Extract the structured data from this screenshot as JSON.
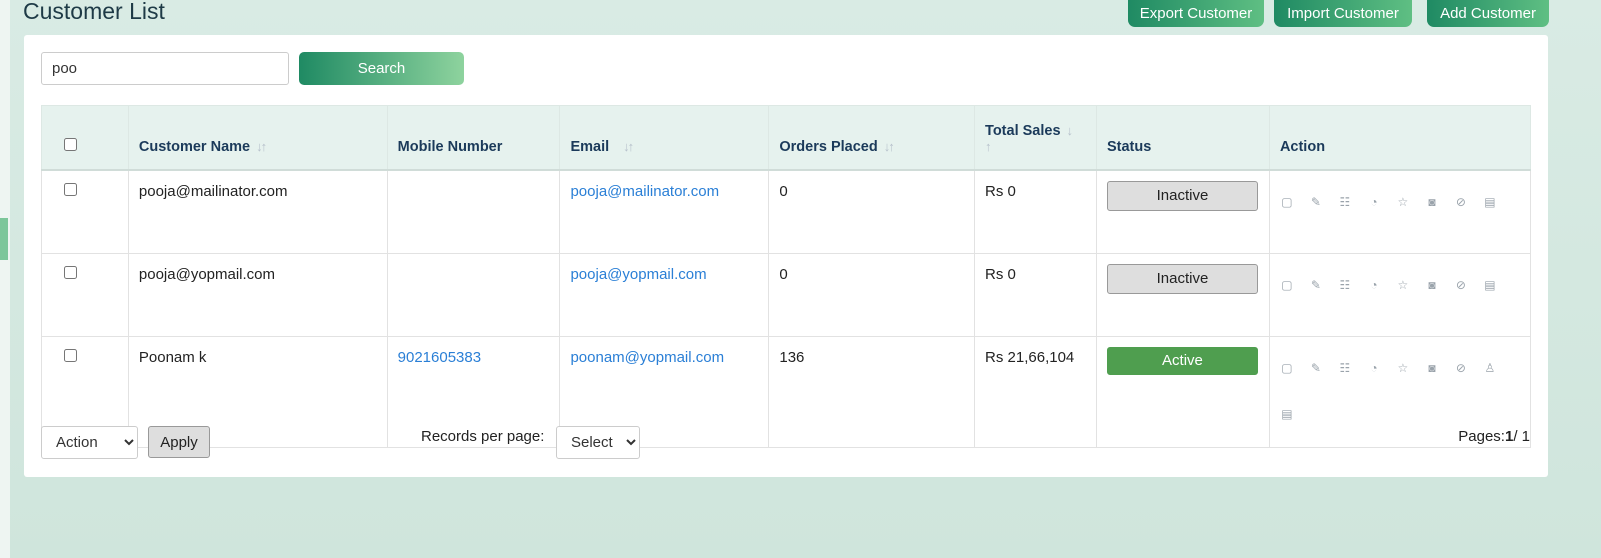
{
  "header": {
    "title": "Customer List",
    "export_label": "Export Customer",
    "import_label": "Import Customer",
    "add_label": "Add Customer"
  },
  "search": {
    "value": "poo",
    "button_label": "Search"
  },
  "table": {
    "columns": {
      "customer_name": "Customer Name",
      "mobile": "Mobile Number",
      "email": "Email",
      "orders": "Orders Placed",
      "total_sales": "Total Sales",
      "status": "Status",
      "action": "Action"
    },
    "rows": [
      {
        "name": "pooja@mailinator.com",
        "mobile": "",
        "email": "pooja@mailinator.com",
        "orders": "0",
        "sales": "Rs 0",
        "status": "Inactive"
      },
      {
        "name": "pooja@yopmail.com",
        "mobile": "",
        "email": "pooja@yopmail.com",
        "orders": "0",
        "sales": "Rs 0",
        "status": "Inactive"
      },
      {
        "name": "Poonam k",
        "mobile": "9021605383",
        "email": "poonam@yopmail.com",
        "orders": "136",
        "sales": "Rs 21,66,104",
        "status": "Active"
      }
    ]
  },
  "footer": {
    "bulk_action": "Action",
    "apply_label": "Apply",
    "records_label": "Records per page:",
    "records_select": "Select",
    "pages_label": "Pages:",
    "pages_current": "1",
    "pages_total": "/ 1"
  },
  "colors": {
    "accent": "#1f8a63",
    "active": "#4f9e4f",
    "link": "#2a7fd6"
  }
}
